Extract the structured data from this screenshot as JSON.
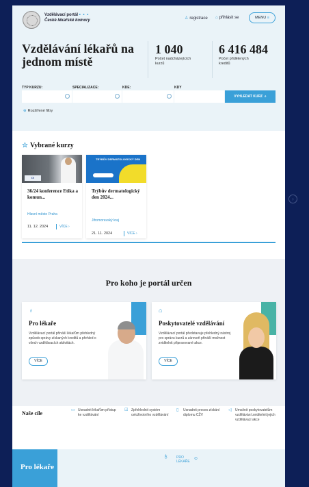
{
  "header": {
    "brand_title": "Vzdělávací portál",
    "brand_dots": "• • •",
    "brand_subtitle": "České lékařské komory",
    "register": "registrace",
    "login": "přihlásit se",
    "menu": "MENU",
    "icons": {
      "register": "user-plus-icon",
      "login": "lock-icon",
      "menu": "hamburger-icon"
    }
  },
  "hero": {
    "title": "Vzdělávání lékařů na jednom místě",
    "stats": [
      {
        "value": "1 040",
        "label": "Počet nadcházejících kurzů"
      },
      {
        "value": "6 416 484",
        "label": "Počet přidělených kreditů"
      }
    ]
  },
  "filters": {
    "labels": [
      "TYP KURZU:",
      "SPECIALIZACE:",
      "KDE:",
      "KDY"
    ],
    "search_button": "VYHLEDAT KURZ",
    "advanced": "Rozšířené filtry"
  },
  "courses": {
    "title": "Vybrané kurzy",
    "items": [
      {
        "title": "36/24 konference Etika a komun...",
        "place": "Hlavní město Praha",
        "date": "11. 12. 2024",
        "more": "VÍCE",
        "image_tag": "IX"
      },
      {
        "title": "Trýbův dermatologický den 2024...",
        "place": "Jihomoravský kraj",
        "date": "21. 11. 2024",
        "more": "VÍCE",
        "image_tag": "TRÝBŮV DERMATOLOGICKÝ DEN"
      }
    ]
  },
  "audience": {
    "title": "Pro koho je portál určen",
    "cards": [
      {
        "title": "Pro lékaře",
        "text": "Vzdělávací portál přináší lékařům přehledný způsob správy získaných kreditů a přehled o všech vzdělávacích aktivitách.",
        "button": "VÍCE",
        "icon": "stethoscope-icon"
      },
      {
        "title": "Poskytovatelé vzdělávání",
        "text": "Vzdělávací portál představuje přehledný nástroj pro správu kurzů a zároveň přináší možnost zviditelnit připravované akce.",
        "button": "VÍCE",
        "icon": "graduation-cap-icon"
      }
    ]
  },
  "goals": {
    "title": "Naše cíle",
    "items": [
      "Usnadnit lékařům přístup ke vzdělávání",
      "Zpřehlednit systém celoživotního vzdělávání",
      "Usnadnit proces získání diplomu CŽV",
      "Umožnit poskytovatelům vzdělávání zviditelnit jejich vzdělávací akce"
    ]
  },
  "bottom": {
    "heading": "Pro lékaře",
    "tab_label": "PRO LÉKAŘE"
  },
  "colors": {
    "accent": "#3aa0d8",
    "frame": "#0d1f57",
    "hero_bg": "#eaf3f8"
  }
}
